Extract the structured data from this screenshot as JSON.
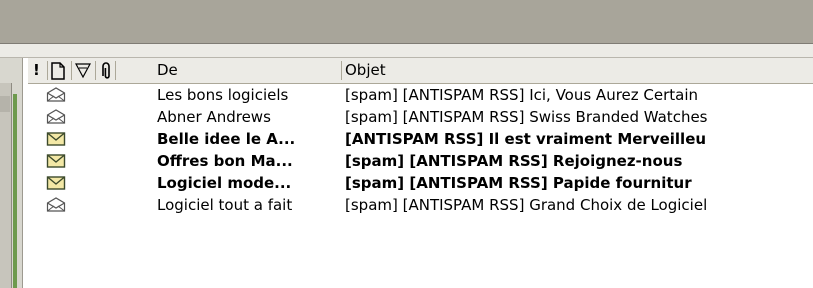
{
  "header": {
    "priority_symbol": "!",
    "de": "De",
    "objet": "Objet"
  },
  "colors": {
    "unread_envelope": "#f3e8a6",
    "read_envelope": "#ffffff"
  },
  "messages": [
    {
      "from": "Les bons logiciels",
      "subject": "[spam] [ANTISPAM RSS] Ici, Vous Aurez Certain",
      "read": true
    },
    {
      "from": "Abner Andrews",
      "subject": "[spam] [ANTISPAM RSS] Swiss Branded Watches",
      "read": true
    },
    {
      "from": "Belle idee le A...",
      "subject": "[ANTISPAM RSS] Il est vraiment Merveilleu",
      "read": false
    },
    {
      "from": "Offres bon Ma...",
      "subject": "[spam] [ANTISPAM RSS] Rejoignez-nous",
      "read": false
    },
    {
      "from": "Logiciel mode...",
      "subject": "[spam] [ANTISPAM RSS] Papide fournitur",
      "read": false
    },
    {
      "from": "Logiciel tout a fait",
      "subject": "[spam] [ANTISPAM RSS] Grand Choix de Logiciel",
      "read": true
    }
  ]
}
